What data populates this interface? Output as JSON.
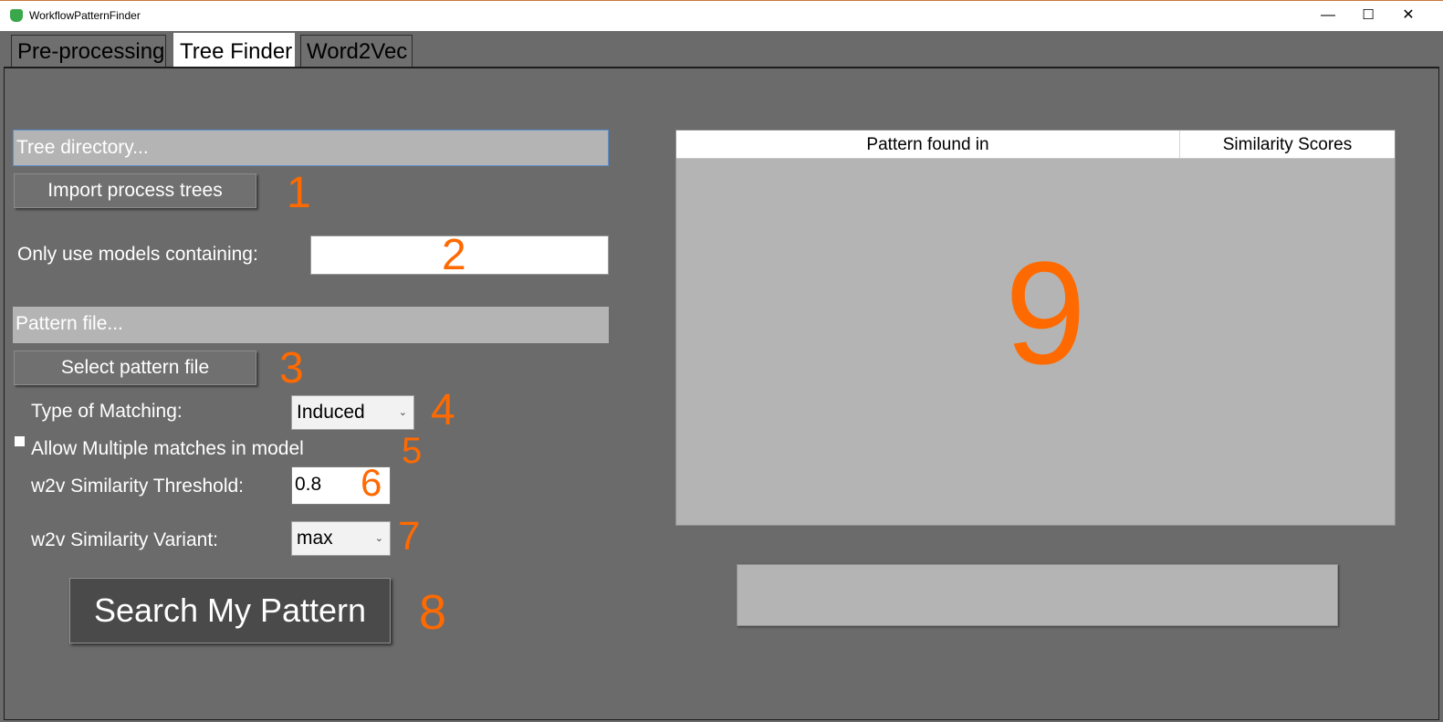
{
  "window": {
    "title": "WorkflowPatternFinder",
    "minimize": "—",
    "maximize": "☐",
    "close": "✕"
  },
  "tabs": [
    {
      "label": "Pre-processing",
      "selected": false
    },
    {
      "label": "Tree Finder",
      "selected": true
    },
    {
      "label": "Word2Vec",
      "selected": false
    }
  ],
  "tree_finder": {
    "tree_directory_placeholder": "Tree directory...",
    "import_button": "Import process trees",
    "only_models_label": "Only use models containing:",
    "only_models_value": "",
    "pattern_file_placeholder": "Pattern file...",
    "select_pattern_button": "Select pattern file",
    "matching_label": "Type of Matching:",
    "matching_value": "Induced",
    "allow_multiple_label": "Allow Multiple matches in model",
    "allow_multiple_checked": false,
    "threshold_label": "w2v Similarity Threshold:",
    "threshold_value": "0.8",
    "variant_label": "w2v Similarity Variant:",
    "variant_value": "max",
    "search_button": "Search My Pattern"
  },
  "results": {
    "columns": [
      "Pattern found in",
      "Similarity Scores"
    ],
    "rows": [],
    "status_text": ""
  },
  "annotations": [
    "1",
    "2",
    "3",
    "4",
    "5",
    "6",
    "7",
    "8",
    "9"
  ],
  "colors": {
    "background": "#6b6b6b",
    "accent_annotation": "#ff6a00",
    "panel": "#b4b4b4"
  }
}
